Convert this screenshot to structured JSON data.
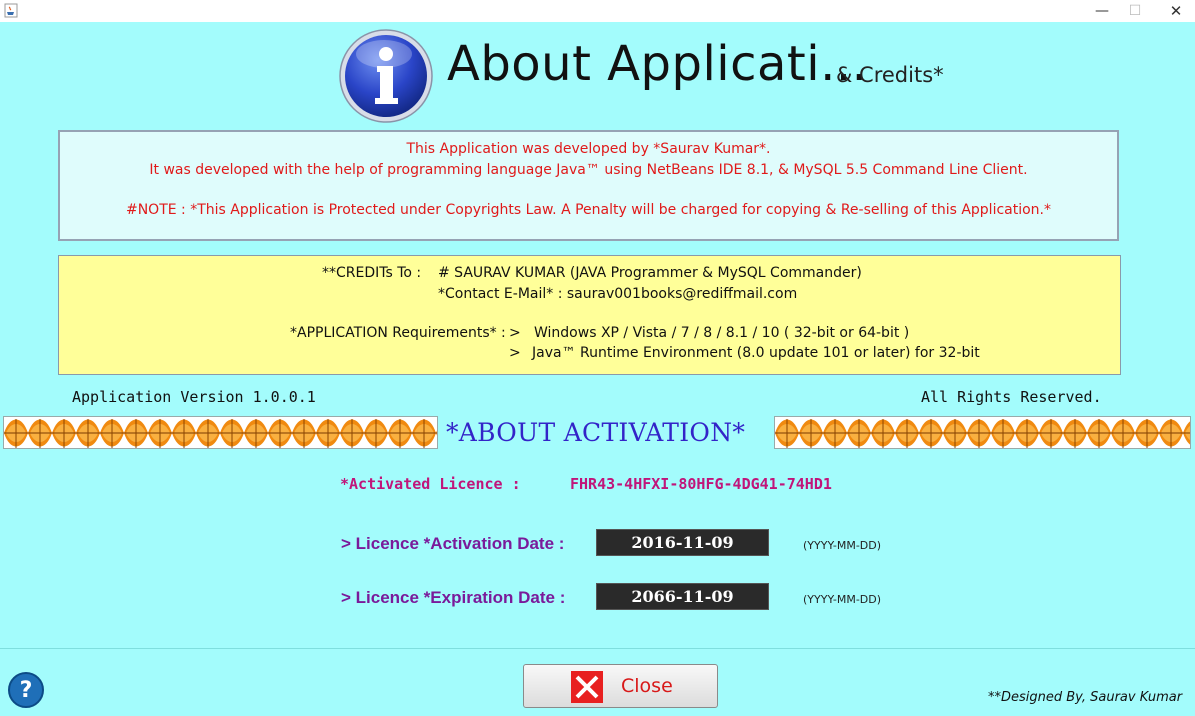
{
  "window": {
    "app_icon": "java-cup-icon",
    "minimize": "—",
    "maximize": "☐",
    "close": "✕"
  },
  "header": {
    "icon": "info-icon",
    "title": "About Applicati...",
    "credits": "& Credits*"
  },
  "developer_note": {
    "line1": "This Application was developed by *Saurav Kumar*.",
    "line2": "It was developed with the help of programming language Java™ using NetBeans IDE 8.1, & MySQL 5.5 Command Line Client.",
    "note": "#NOTE : *This Application is Protected under Copyrights Law.  A Penalty will be charged for copying & Re-selling of this Application.*"
  },
  "credits": {
    "label": "**CREDITs To :",
    "name": "# SAURAV  KUMAR  (JAVA Programmer & MySQL Commander)",
    "contact": "*Contact  E-Mail* : saurav001books@rediffmail.com",
    "requirements_label": "*APPLICATION Requirements* :",
    "req1_marker": ">",
    "req1": "Windows XP / Vista / 7 / 8 / 8.1 / 10   ( 32-bit or 64-bit )",
    "req2_marker": ">",
    "req2": "Java™ Runtime Environment (8.0 update 101 or later)  for 32-bit"
  },
  "footer_info": {
    "version": "Application Version 1.0.0.1",
    "rights": "All Rights Reserved."
  },
  "activation": {
    "title": "*ABOUT ACTIVATION*",
    "licence_label": "*Activated Licence  :",
    "licence_key": "FHR43-4HFXI-80HFG-4DG41-74HD1",
    "activation_label": "> Licence *Activation Date :",
    "activation_date": "2016-11-09",
    "activation_format": "(YYYY-MM-DD)",
    "expiration_label": "> Licence *Expiration Date :",
    "expiration_date": "2066-11-09",
    "expiration_format": "(YYYY-MM-DD)"
  },
  "bottom": {
    "help_icon": "?",
    "close_label": "Close",
    "designed_by": "**Designed By, Saurav Kumar"
  },
  "colors": {
    "background": "#a3fcfc",
    "dev_text": "#e01a1a",
    "credits_bg": "#ffff99",
    "activation_title": "#3324c8",
    "licence": "#c0157a",
    "date_label": "#7a1a9a"
  }
}
